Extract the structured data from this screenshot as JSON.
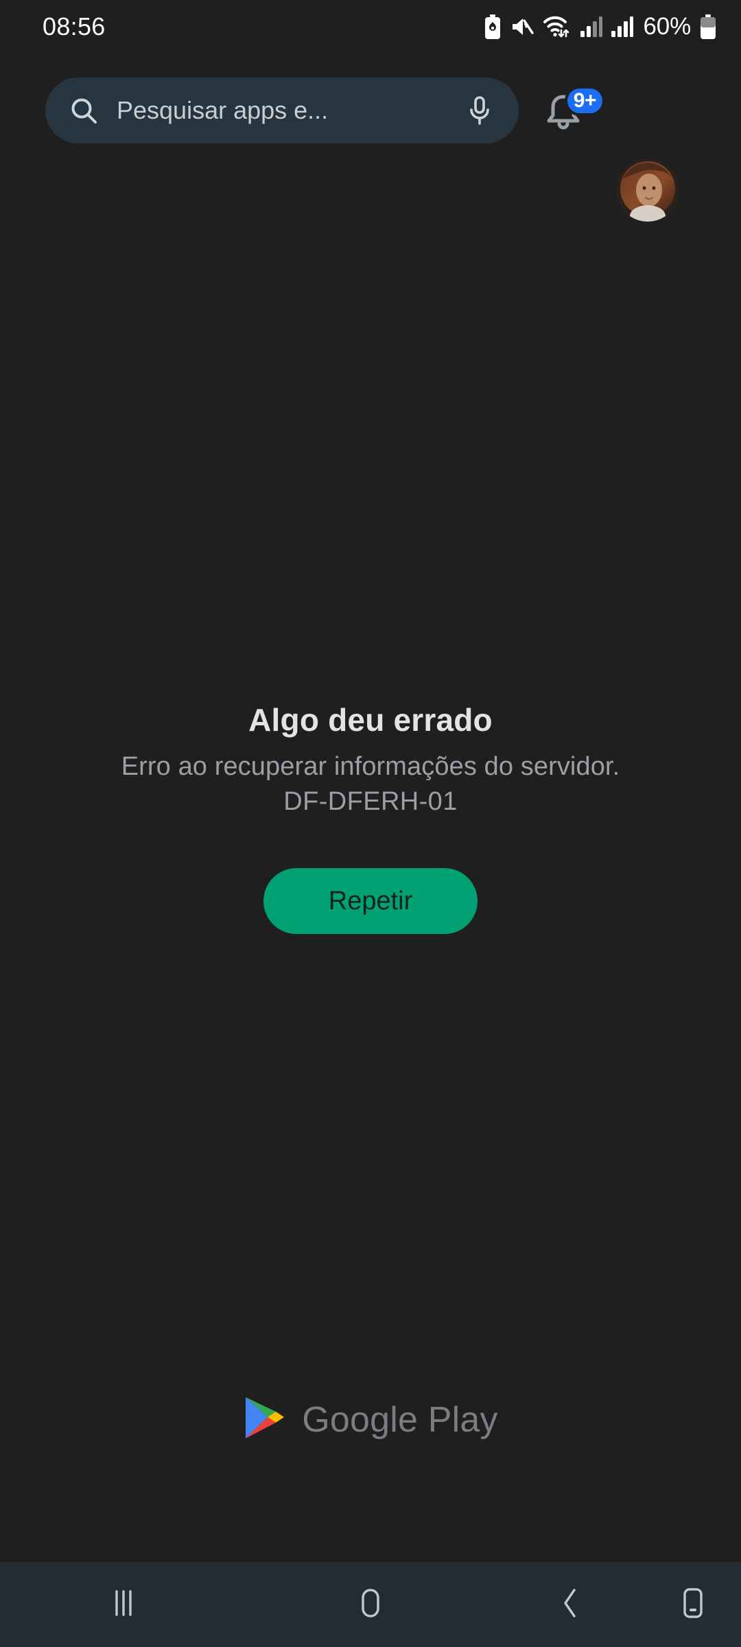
{
  "status_bar": {
    "clock": "08:56",
    "battery_percent": "60%",
    "icons": [
      "battery-saver-icon",
      "mute-icon",
      "wifi-data-icon",
      "signal-bars-sim1-icon",
      "signal-bars-sim2-icon"
    ]
  },
  "search": {
    "placeholder": "Pesquisar apps e...",
    "search_icon": "search-icon",
    "mic_icon": "microphone-icon"
  },
  "notifications": {
    "bell_icon": "bell-icon",
    "badge_count": "9+",
    "badge_color": "#1b6ef3"
  },
  "account": {
    "avatar_label": "avatar"
  },
  "error": {
    "title": "Algo deu errado",
    "description": "Erro ao recuperar informações do servidor.",
    "code": "DF-DFERH-01",
    "retry_label": "Repetir",
    "retry_color": "#01a173"
  },
  "footer": {
    "wordmark": "Google Play",
    "logo_icon": "google-play-logo-icon",
    "logo_colors": {
      "blue": "#4285f4",
      "green": "#34a853",
      "yellow": "#fbbc04",
      "red": "#ea4335"
    }
  },
  "nav_bar": {
    "recents_label": "recents-icon",
    "home_label": "home-icon",
    "back_label": "back-icon",
    "device_label": "device-icon",
    "background": "#232c33"
  },
  "theme": {
    "background": "#1f1f1f",
    "search_bar_background": "#273540"
  }
}
